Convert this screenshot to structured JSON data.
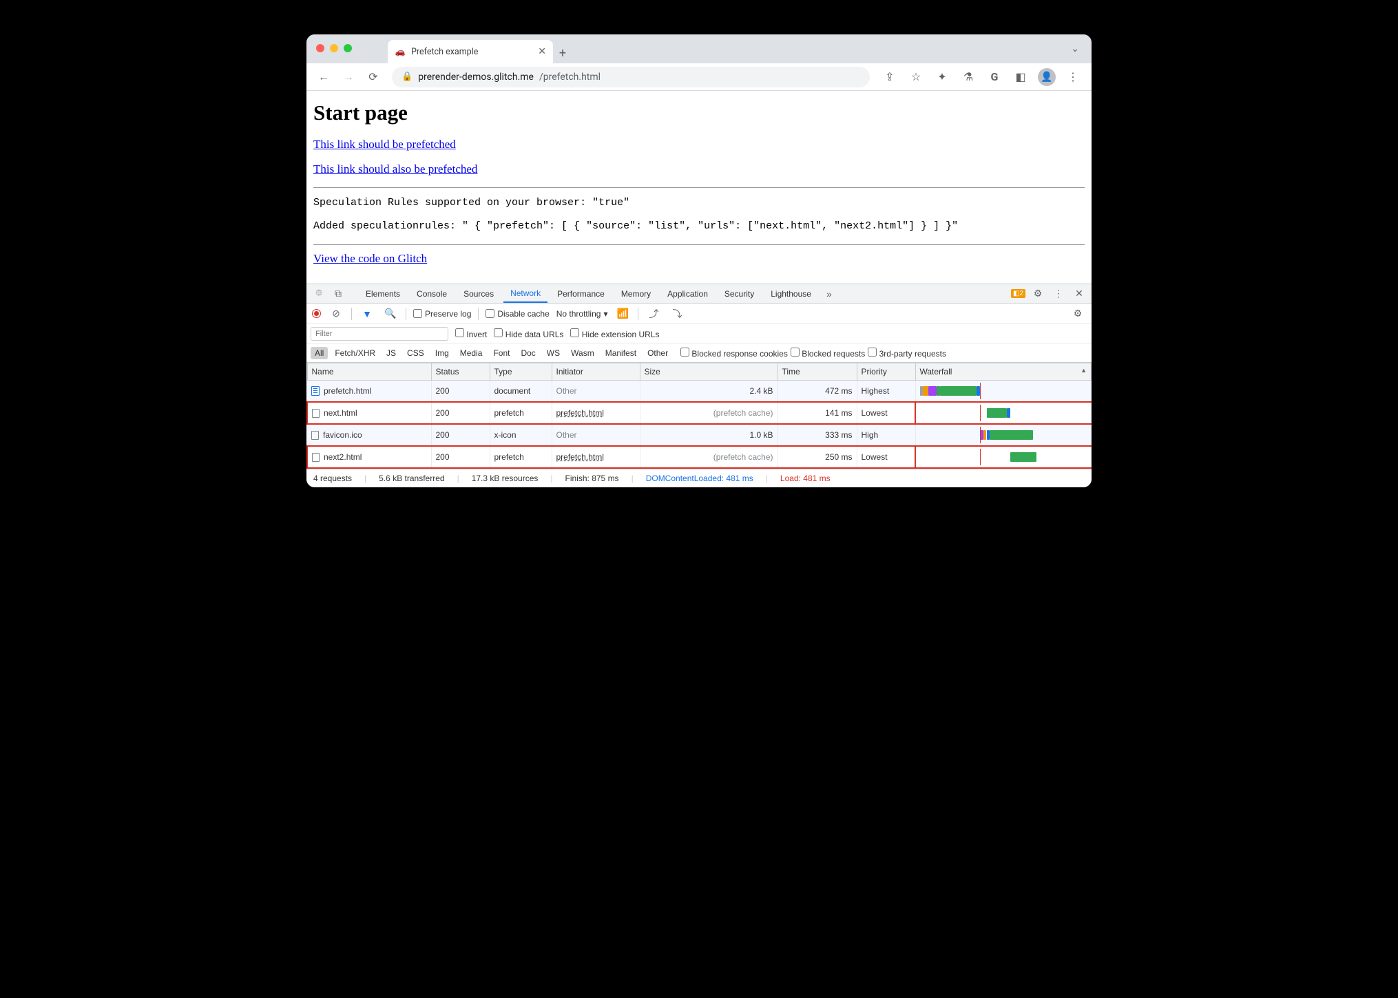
{
  "tab": {
    "title": "Prefetch example"
  },
  "url": {
    "host": "prerender-demos.glitch.me",
    "path": "/prefetch.html"
  },
  "page": {
    "heading": "Start page",
    "link1": "This link should be prefetched",
    "link2": "This link should also be prefetched",
    "mono1": "Speculation Rules supported on your browser: \"true\"",
    "mono2": "Added speculationrules: \" { \"prefetch\": [ { \"source\": \"list\", \"urls\": [\"next.html\", \"next2.html\"] } ] }\"",
    "link3": "View the code on Glitch"
  },
  "devtools": {
    "tabs": [
      "Elements",
      "Console",
      "Sources",
      "Network",
      "Performance",
      "Memory",
      "Application",
      "Security",
      "Lighthouse"
    ],
    "active": "Network",
    "warnings": "2",
    "preserve": "Preserve log",
    "disable": "Disable cache",
    "throttling": "No throttling",
    "filter_ph": "Filter",
    "invert": "Invert",
    "hide_data": "Hide data URLs",
    "hide_ext": "Hide extension URLs",
    "types": [
      "All",
      "Fetch/XHR",
      "JS",
      "CSS",
      "Img",
      "Media",
      "Font",
      "Doc",
      "WS",
      "Wasm",
      "Manifest",
      "Other"
    ],
    "blocked_cookies": "Blocked response cookies",
    "blocked_req": "Blocked requests",
    "thirdparty": "3rd-party requests",
    "cols": {
      "name": "Name",
      "status": "Status",
      "type": "Type",
      "initiator": "Initiator",
      "size": "Size",
      "time": "Time",
      "priority": "Priority",
      "waterfall": "Waterfall"
    },
    "rows": [
      {
        "name": "prefetch.html",
        "status": "200",
        "type": "document",
        "initiator": "Other",
        "initiator_muted": true,
        "size": "2.4 kB",
        "size_muted": false,
        "time": "472 ms",
        "priority": "Highest",
        "icon": "doc",
        "circled": false,
        "wf": [
          {
            "l": 0,
            "w": 2,
            "c": "#9aa0a6"
          },
          {
            "l": 2,
            "w": 3,
            "c": "#f29900"
          },
          {
            "l": 5,
            "w": 5,
            "c": "#a142f4"
          },
          {
            "l": 10,
            "w": 2,
            "c": "#34a853"
          },
          {
            "l": 12,
            "w": 22,
            "c": "#34a853"
          },
          {
            "l": 34,
            "w": 2,
            "c": "#1a73e8"
          }
        ]
      },
      {
        "name": "next.html",
        "status": "200",
        "type": "prefetch",
        "initiator": "prefetch.html",
        "initiator_muted": false,
        "size": "(prefetch cache)",
        "size_muted": true,
        "time": "141 ms",
        "priority": "Lowest",
        "icon": "empty",
        "circled": true,
        "wf": [
          {
            "l": 40,
            "w": 12,
            "c": "#34a853"
          },
          {
            "l": 52,
            "w": 2,
            "c": "#1a73e8"
          }
        ]
      },
      {
        "name": "favicon.ico",
        "status": "200",
        "type": "x-icon",
        "initiator": "Other",
        "initiator_muted": true,
        "size": "1.0 kB",
        "size_muted": false,
        "time": "333 ms",
        "priority": "High",
        "icon": "empty",
        "circled": false,
        "wf": [
          {
            "l": 36,
            "w": 2,
            "c": "#a142f4"
          },
          {
            "l": 38,
            "w": 2,
            "c": "#f29900"
          },
          {
            "l": 40,
            "w": 2,
            "c": "#1a73e8"
          },
          {
            "l": 42,
            "w": 26,
            "c": "#34a853"
          }
        ]
      },
      {
        "name": "next2.html",
        "status": "200",
        "type": "prefetch",
        "initiator": "prefetch.html",
        "initiator_muted": false,
        "size": "(prefetch cache)",
        "size_muted": true,
        "time": "250 ms",
        "priority": "Lowest",
        "icon": "empty",
        "circled": true,
        "wf": [
          {
            "l": 54,
            "w": 16,
            "c": "#34a853"
          }
        ]
      }
    ],
    "status": {
      "requests": "4 requests",
      "transferred": "5.6 kB transferred",
      "resources": "17.3 kB resources",
      "finish": "Finish: 875 ms",
      "dcl": "DOMContentLoaded: 481 ms",
      "load": "Load: 481 ms"
    }
  }
}
